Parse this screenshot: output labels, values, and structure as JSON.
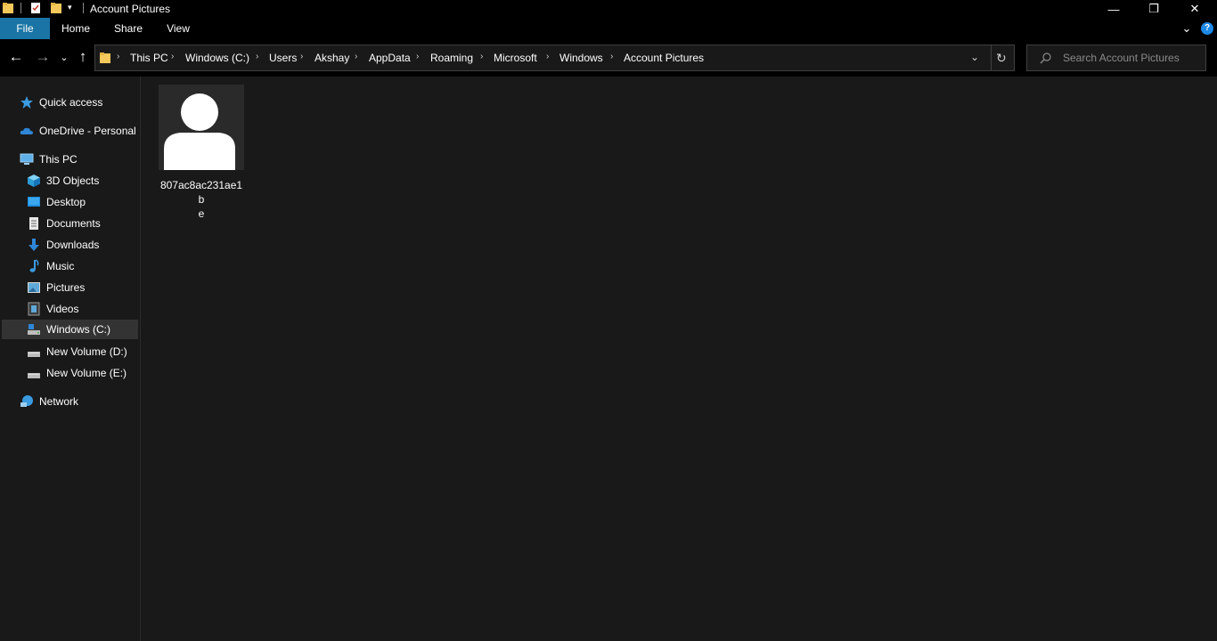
{
  "window": {
    "title": "Account Pictures",
    "minimize_glyph": "—",
    "restore_glyph": "❐",
    "close_glyph": "✕"
  },
  "ribbon": {
    "tabs": [
      "File",
      "Home",
      "Share",
      "View"
    ],
    "expand_glyph": "⌄",
    "help_glyph": "?"
  },
  "nav": {
    "back_glyph": "←",
    "forward_glyph": "→",
    "recent_glyph": "⌄",
    "up_glyph": "↑"
  },
  "address": {
    "breadcrumbs": [
      "This PC",
      "Windows (C:)",
      "Users",
      "Akshay",
      "AppData",
      "Roaming",
      "Microsoft",
      "Windows",
      "Account Pictures"
    ],
    "separator": "›",
    "dropdown_glyph": "⌄",
    "refresh_glyph": "↻"
  },
  "search": {
    "placeholder": "Search Account Pictures"
  },
  "sidebar": {
    "items": [
      {
        "label": "Quick access",
        "icon": "star-icon"
      },
      {
        "label": "OneDrive - Personal",
        "icon": "cloud-icon"
      },
      {
        "label": "This PC",
        "icon": "computer-icon"
      },
      {
        "label": "3D Objects",
        "icon": "cube-icon"
      },
      {
        "label": "Desktop",
        "icon": "desktop-icon"
      },
      {
        "label": "Documents",
        "icon": "document-icon"
      },
      {
        "label": "Downloads",
        "icon": "download-icon"
      },
      {
        "label": "Music",
        "icon": "music-icon"
      },
      {
        "label": "Pictures",
        "icon": "picture-icon"
      },
      {
        "label": "Videos",
        "icon": "video-icon"
      },
      {
        "label": "Windows (C:)",
        "icon": "drive-icon",
        "selected": true
      },
      {
        "label": "New Volume (D:)",
        "icon": "drive-icon"
      },
      {
        "label": "New Volume (E:)",
        "icon": "drive-icon"
      },
      {
        "label": "Network",
        "icon": "network-icon"
      }
    ]
  },
  "files": [
    {
      "name_line1": "807ac8ac231ae1b",
      "name_line2": "e",
      "icon": "user-silhouette-icon"
    }
  ],
  "colors": {
    "accent": "#1a75a6",
    "background": "#191919",
    "chrome": "#000000",
    "selected": "#333333"
  }
}
